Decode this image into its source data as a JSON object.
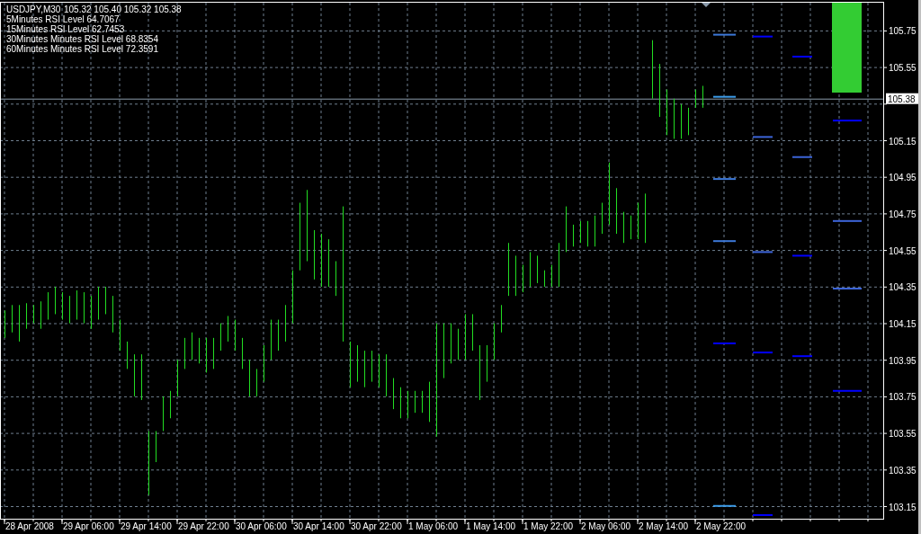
{
  "header": {
    "symbol": "USDJPY,M30",
    "quote": "105.32 105.40 105.32 105.38"
  },
  "indicators": [
    "5Minutes RSI Level 64.7067",
    "15Minutes RSI Level 62.7453",
    "30Minutes Minutes RSI Level 68.8354",
    "60Minutes Minutes RSI Level 72.3591"
  ],
  "current_price": "105.38",
  "price_axis": [
    "105.75",
    "105.55",
    "105.15",
    "104.95",
    "104.75",
    "104.55",
    "104.35",
    "104.15",
    "103.95",
    "103.75",
    "103.55",
    "103.35",
    "103.15"
  ],
  "time_axis": [
    "28 Apr 2008",
    "29 Apr 06:00",
    "29 Apr 14:00",
    "29 Apr 22:00",
    "30 Apr 06:00",
    "30 Apr 14:00",
    "30 Apr 22:00",
    "1 May 06:00",
    "1 May 14:00",
    "1 May 22:00",
    "2 May 06:00",
    "2 May 14:00",
    "2 May 22:00"
  ]
}
